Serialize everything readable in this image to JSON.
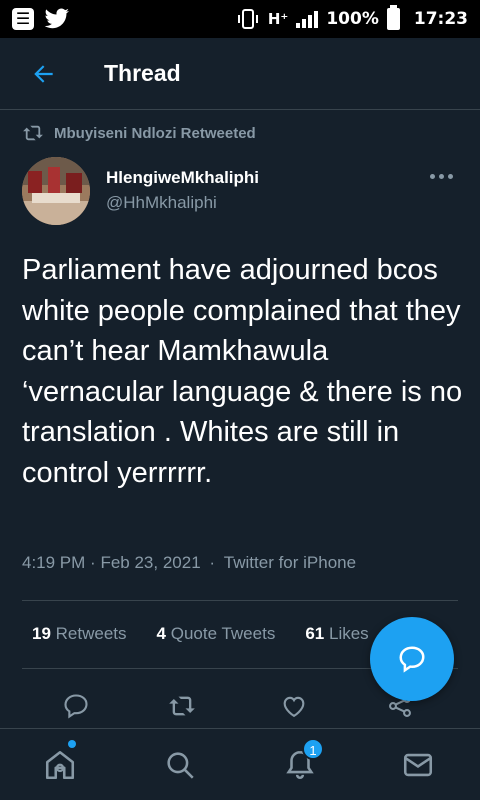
{
  "status_bar": {
    "app_icon_1": "sim-card-icon",
    "app_icon_2": "twitter-bird-icon",
    "network": "H⁺",
    "battery": "100%",
    "time": "17:23"
  },
  "header": {
    "title": "Thread",
    "back_icon": "back-arrow-icon"
  },
  "retweet": {
    "label": "Mbuyiseni Ndlozi Retweeted"
  },
  "tweet": {
    "author_name": "HlengiweMkhaliphi",
    "author_handle": "@HhMkhaliphi",
    "text": "Parliament have adjourned bcos white people complained that they can’t hear Mamkhawula ‘vernacular language & there is no translation . Whites are still in control yerrrrrr.",
    "time": "4:19 PM",
    "date": "Feb 23, 2021",
    "source": "Twitter for iPhone",
    "separator": "·"
  },
  "stats": {
    "retweets_count": "19",
    "retweets_label": "Retweets",
    "quotes_count": "4",
    "quotes_label": "Quote Tweets",
    "likes_count": "61",
    "likes_label": "Likes"
  },
  "bottom_nav": {
    "notifications_badge": "1"
  },
  "colors": {
    "background": "#15202b",
    "accent": "#1da1f2",
    "muted_text": "#8899a6",
    "divider": "#38444d"
  }
}
